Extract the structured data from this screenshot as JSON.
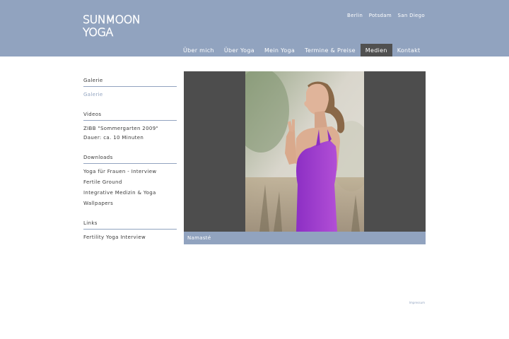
{
  "brand": {
    "line1": "SUNMOON",
    "line2": "YOGA"
  },
  "cities": [
    "Berlin",
    "Potsdam",
    "San Diego"
  ],
  "nav": [
    {
      "label": "Über mich"
    },
    {
      "label": "Über Yoga"
    },
    {
      "label": "Mein Yoga"
    },
    {
      "label": "Termine & Preise"
    },
    {
      "label": "Medien",
      "active": true
    },
    {
      "label": "Kontakt"
    }
  ],
  "sidebar": {
    "sections": [
      {
        "heading": "Galerie",
        "items": [
          "Galerie"
        ]
      },
      {
        "heading": "Videos",
        "items": [
          "ZIBB \"Sommergarten 2009\" Dauer: ca. 10 Minuten"
        ]
      },
      {
        "heading": "Downloads",
        "items": [
          "Yoga für Frauen - Interview",
          "Fertile Ground",
          "Integrative Medizin & Yoga",
          "Wallpapers"
        ]
      },
      {
        "heading": "Links",
        "items": [
          "Fertility Yoga Interview"
        ]
      }
    ]
  },
  "gallery": {
    "caption": "Namasté"
  },
  "footer": {
    "imprint": "Impressum"
  },
  "colors": {
    "accent": "#91a3bf",
    "active_nav": "#505050",
    "gallery_bg": "#4d4d4d"
  }
}
